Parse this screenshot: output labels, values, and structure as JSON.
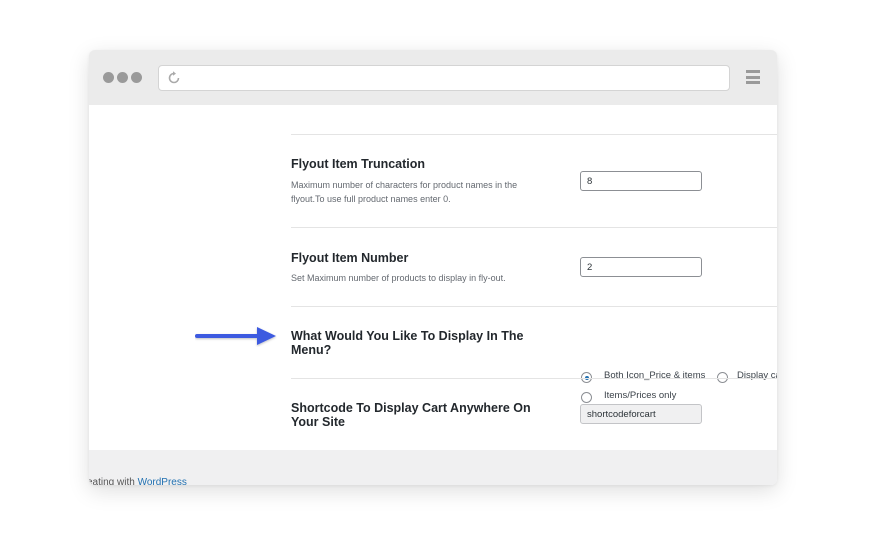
{
  "settings": {
    "truncation": {
      "title": "Flyout Item Truncation",
      "desc_line1": "Maximum number of characters for product names in the",
      "desc_line2": "flyout.To use full product names enter 0.",
      "value": "8"
    },
    "number": {
      "title": "Flyout Item Number",
      "desc": "Set Maximum number of products to display in fly-out.",
      "value": "2"
    },
    "display": {
      "title_line1": "What Would You Like To Display In The",
      "title_line2": "Menu?",
      "options": [
        {
          "label": "Both Icon_Price & items",
          "checked": true
        },
        {
          "label": "Display ca",
          "checked": false
        },
        {
          "label": "Items/Prices only",
          "checked": false
        }
      ]
    },
    "shortcode": {
      "title_line1": "Shortcode To Display Cart Anywhere On",
      "title_line2": "Your Site",
      "value": "shortcodeforcart"
    }
  },
  "footer": {
    "prefix": "eating with ",
    "link": "WordPress"
  },
  "colors": {
    "arrow": "#3d5ae0",
    "radio_checked": "#2271b1"
  }
}
